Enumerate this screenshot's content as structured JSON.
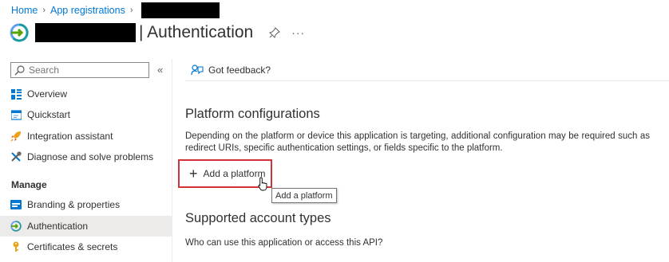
{
  "breadcrumb": {
    "home": "Home",
    "app_registrations": "App registrations"
  },
  "header": {
    "title": "| Authentication"
  },
  "sidebar": {
    "search_placeholder": "Search",
    "collapse_label": "«",
    "items_top": [
      {
        "label": "Overview",
        "icon": "overview-icon"
      },
      {
        "label": "Quickstart",
        "icon": "quickstart-icon"
      },
      {
        "label": "Integration assistant",
        "icon": "rocket-icon"
      },
      {
        "label": "Diagnose and solve problems",
        "icon": "wrench-icon"
      }
    ],
    "manage_header": "Manage",
    "items_manage": [
      {
        "label": "Branding & properties",
        "icon": "branding-icon"
      },
      {
        "label": "Authentication",
        "icon": "authentication-icon",
        "active": true
      },
      {
        "label": "Certificates & secrets",
        "icon": "key-icon"
      }
    ]
  },
  "main": {
    "feedback_label": "Got feedback?",
    "platform_heading": "Platform configurations",
    "platform_description": "Depending on the platform or device this application is targeting, additional configuration may be required such as redirect URIs, specific authentication settings, or fields specific to the platform.",
    "add_platform_label": "Add a platform",
    "tooltip": "Add a platform",
    "account_heading": "Supported account types",
    "account_question": "Who can use this application or access this API?"
  },
  "colors": {
    "accent": "#0078d4",
    "highlight_border": "#d13438",
    "active_nav": "#edebe9"
  }
}
